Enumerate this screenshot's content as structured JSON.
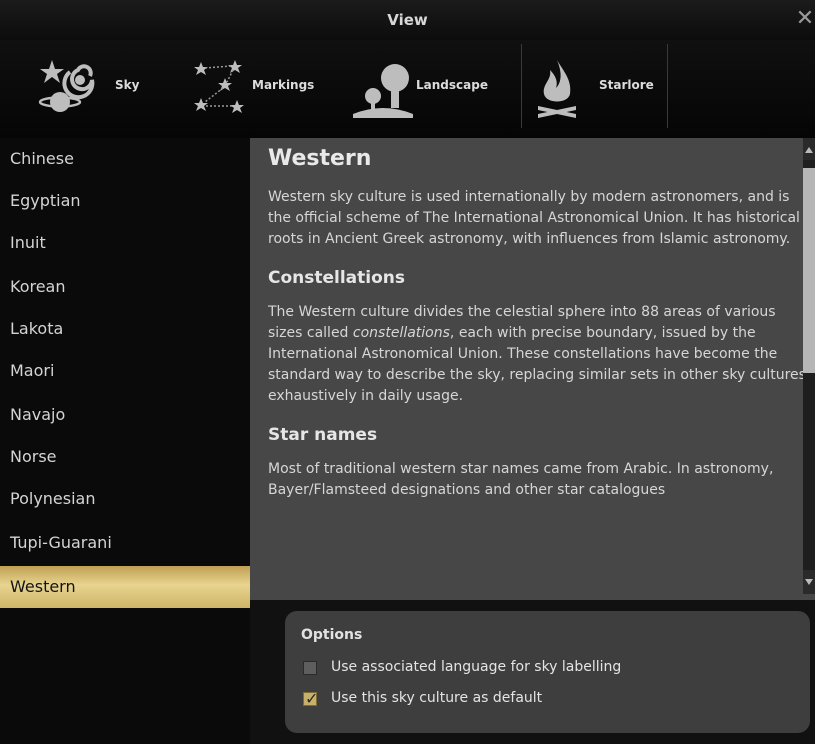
{
  "window": {
    "title": "View",
    "close_glyph": "✕"
  },
  "tabs": [
    {
      "label": "Sky",
      "icon": "sky-icon"
    },
    {
      "label": "Markings",
      "icon": "markings-icon"
    },
    {
      "label": "Landscape",
      "icon": "landscape-icon"
    },
    {
      "label": "Starlore",
      "icon": "starlore-icon"
    }
  ],
  "cultures": [
    "Chinese",
    "Egyptian",
    "Inuit",
    "Korean",
    "Lakota",
    "Maori",
    "Navajo",
    "Norse",
    "Polynesian",
    "Tupi-Guarani",
    "Western"
  ],
  "selected_culture": "Western",
  "description": {
    "title": "Western",
    "intro": "Western sky culture is used internationally by modern astronomers, and is the official scheme of The International Astronomical Union. It has historical roots in Ancient Greek astronomy, with influences from Islamic astronomy.",
    "constellations_heading": "Constellations",
    "constellations_before": "The Western culture divides the celestial sphere into 88 areas of various sizes called ",
    "constellations_em": "constellations",
    "constellations_after": ", each with precise boundary, issued by the International Astronomical Union. These constellations have become the standard way to describe the sky, replacing similar sets in other sky cultures exhaustively in daily usage.",
    "star_names_heading": "Star names",
    "star_names_text": "Most of traditional western star names came from Arabic. In astronomy, Bayer/Flamsteed designations and other star catalogues"
  },
  "options": {
    "title": "Options",
    "items": [
      {
        "label": "Use associated language for sky labelling",
        "checked": false
      },
      {
        "label": "Use this sky culture as default",
        "checked": true
      }
    ]
  },
  "colors": {
    "selected_item": "#d9c27a",
    "pane_background": "#474747",
    "list_background": "#0a0a0a"
  }
}
